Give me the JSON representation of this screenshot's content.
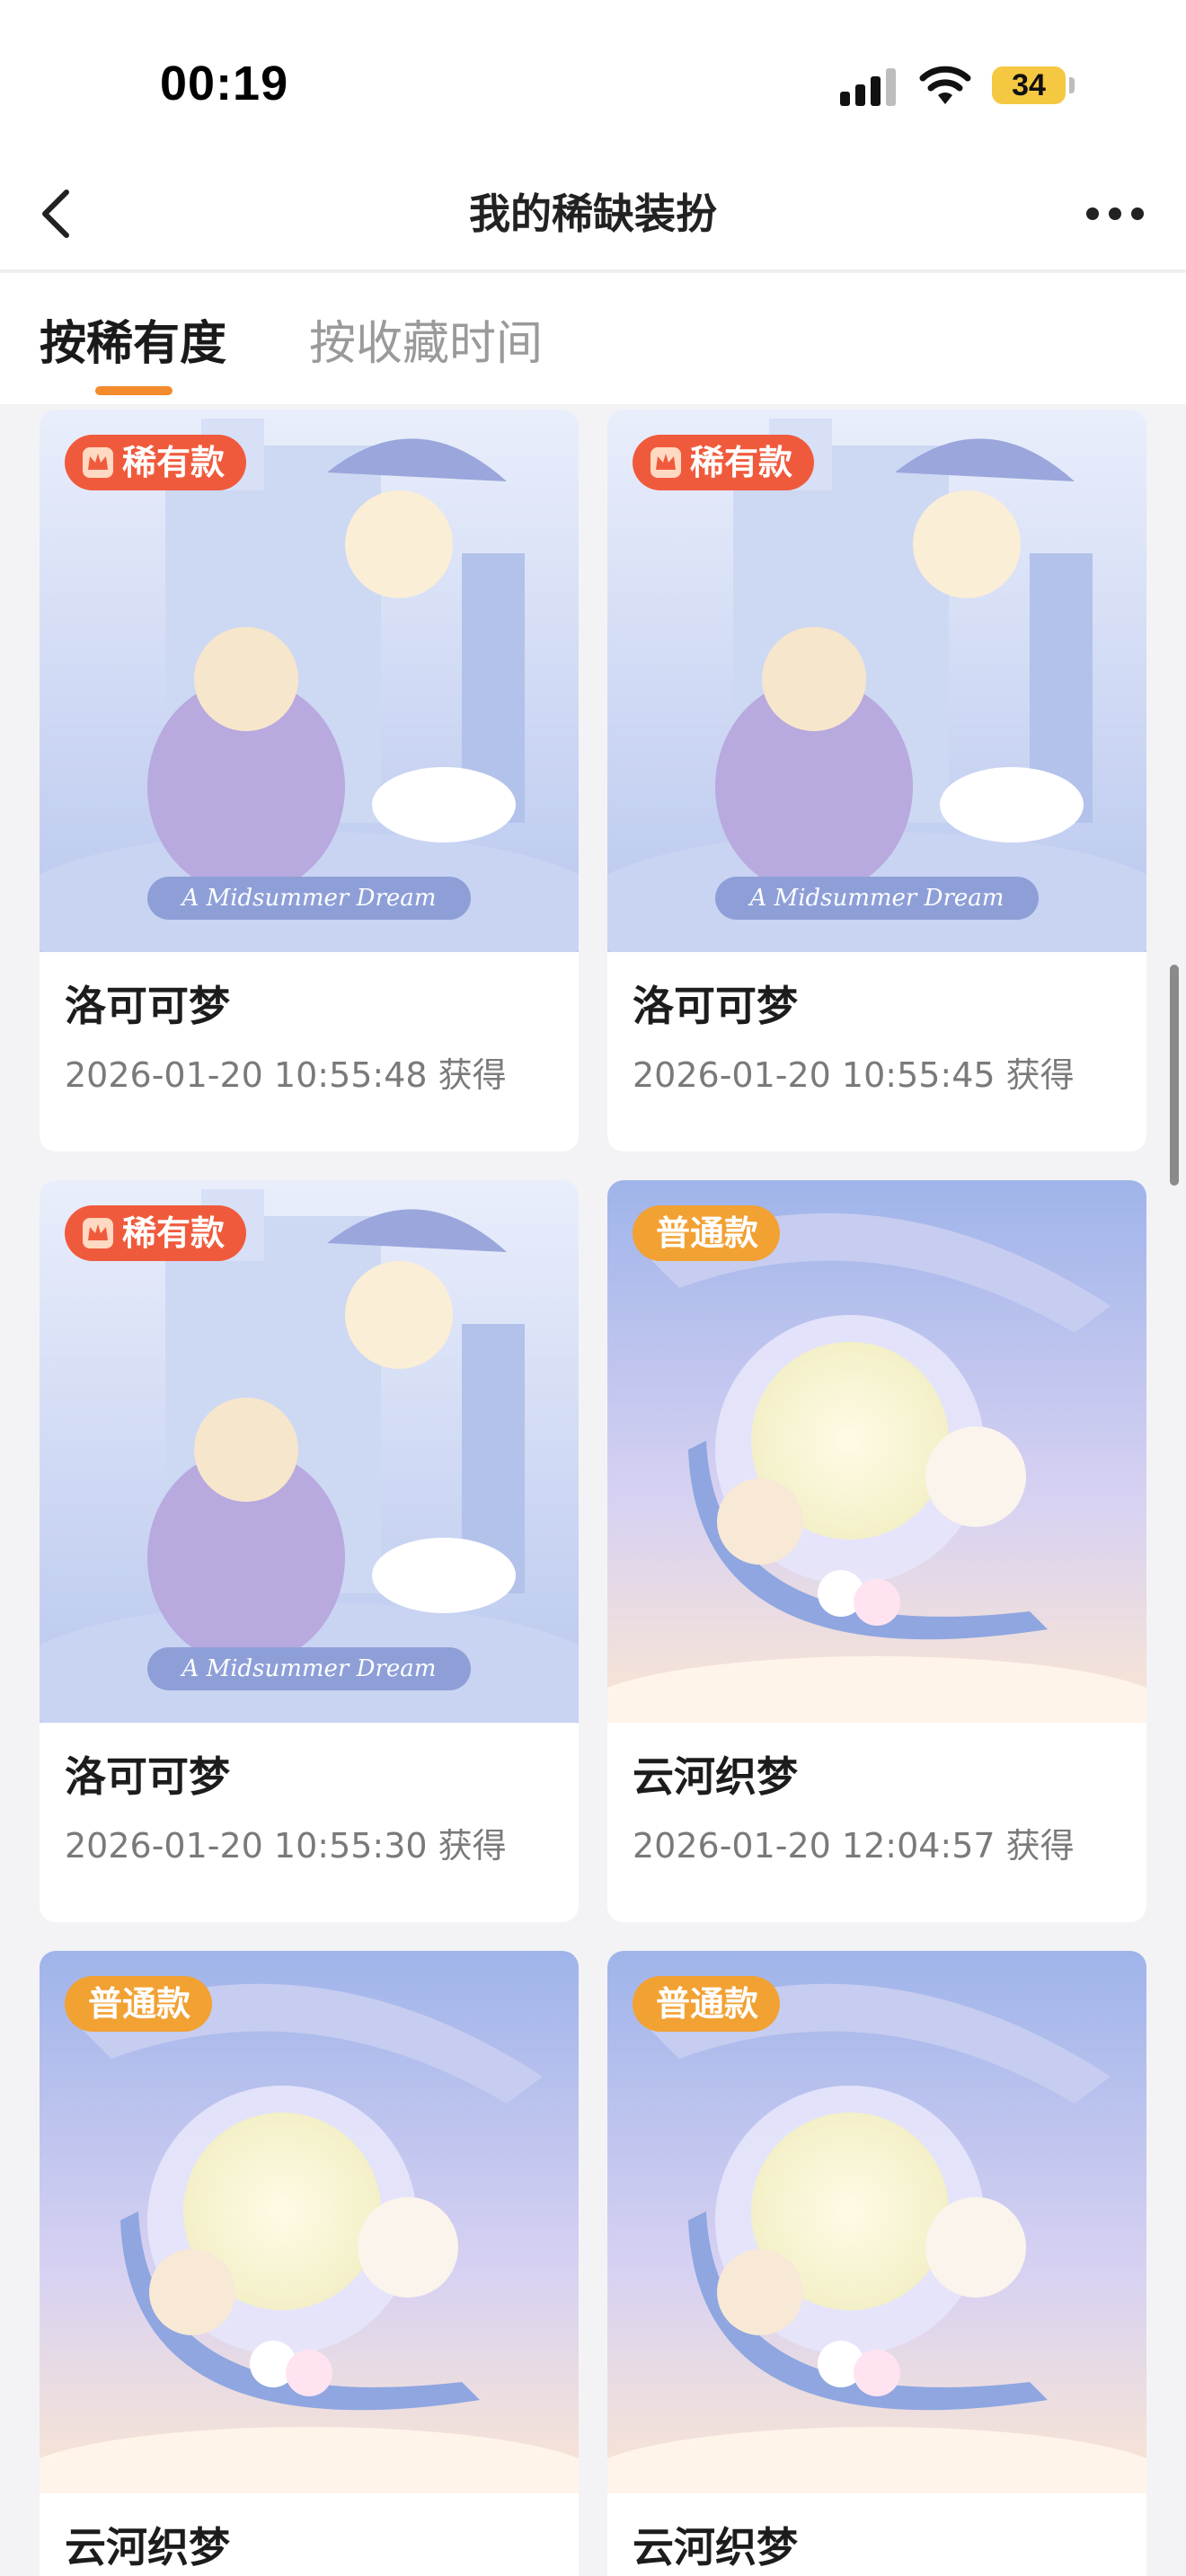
{
  "status_bar": {
    "time": "00:19",
    "battery": "34",
    "icons": [
      "signal-icon",
      "wifi-icon",
      "battery-icon"
    ],
    "battery_color": "#f5c842"
  },
  "nav": {
    "title": "我的稀缺装扮",
    "icons": [
      "back-icon",
      "more-icon"
    ]
  },
  "tabs": [
    {
      "label": "按稀有度",
      "active": true
    },
    {
      "label": "按收藏时间",
      "active": false
    }
  ],
  "accent_color": "#f38a2c",
  "badge_colors": {
    "rare": "#f05a3c",
    "normal": "#f2a133"
  },
  "cards": [
    {
      "badge": "稀有款",
      "badge_type": "rare",
      "name": "洛可可梦",
      "time": "2026-01-20 10:55:48 获得",
      "art_caption": "A Midsummer Dream"
    },
    {
      "badge": "稀有款",
      "badge_type": "rare",
      "name": "洛可可梦",
      "time": "2026-01-20 10:55:45 获得",
      "art_caption": "A Midsummer Dream"
    },
    {
      "badge": "稀有款",
      "badge_type": "rare",
      "name": "洛可可梦",
      "time": "2026-01-20 10:55:30 获得",
      "art_caption": "A Midsummer Dream"
    },
    {
      "badge": "普通款",
      "badge_type": "normal",
      "name": "云河织梦",
      "time": "2026-01-20 12:04:57 获得",
      "art_caption": ""
    },
    {
      "badge": "普通款",
      "badge_type": "normal",
      "name": "云河织梦",
      "time": "",
      "art_caption": ""
    },
    {
      "badge": "普通款",
      "badge_type": "normal",
      "name": "云河织梦",
      "time": "",
      "art_caption": ""
    }
  ]
}
